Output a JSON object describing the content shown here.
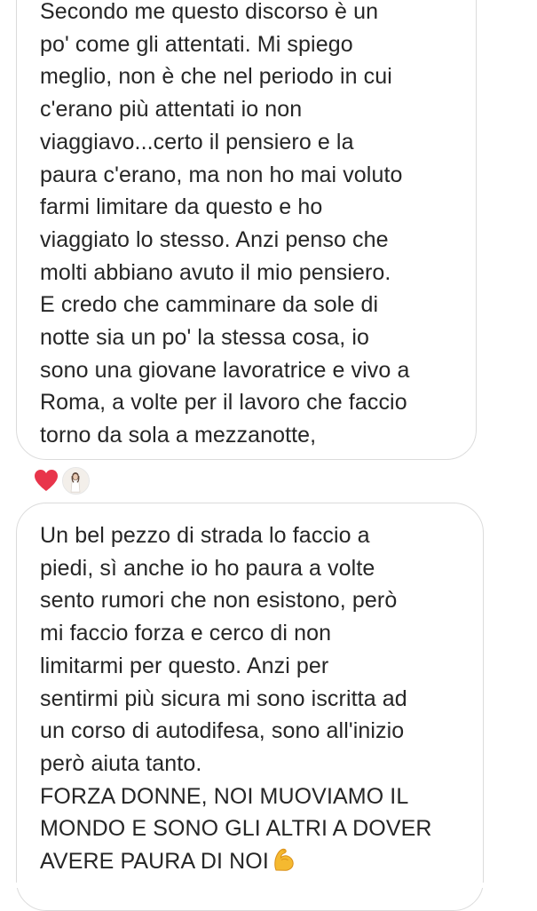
{
  "messages": [
    {
      "lines": [
        "Secondo me questo discorso è un",
        "po' come gli attentati. Mi spiego",
        "meglio, non è che nel periodo in cui",
        "c'erano più attentati io non",
        "viaggiavo...certo il pensiero e la",
        "paura c'erano, ma non ho mai voluto",
        "farmi limitare da questo e ho",
        "viaggiato lo stesso. Anzi penso che",
        "molti abbiano avuto il mio pensiero.",
        "E credo che camminare da sole di",
        "notte sia un po' la stessa cosa, io",
        "sono una giovane lavoratrice e vivo a",
        "Roma, a volte per il lavoro che faccio",
        "torno da sola a mezzanotte,"
      ],
      "reactions": [
        {
          "icon": "heart-icon",
          "color": "#e8354b"
        },
        {
          "icon": "reactor-avatar"
        }
      ]
    },
    {
      "lines": [
        "Un bel pezzo di strada lo faccio a",
        "piedi, sì anche io ho paura a volte",
        "sento rumori che non esistono, però",
        "mi faccio forza e cerco di non",
        "limitarmi per questo. Anzi per",
        "sentirmi più sicura mi sono iscritta ad",
        "un corso di autodifesa, sono all'inizio",
        "però aiuta tanto.",
        "FORZA DONNE, NOI MUOVIAMO IL",
        "MONDO E SONO GLI ALTRI A DOVER",
        "AVERE PAURA DI NOI"
      ],
      "trailing_emoji": "flexed-biceps-icon"
    }
  ],
  "colors": {
    "text": "#262626",
    "bubble_border": "#dbdbdb",
    "heart": "#e8354b",
    "emoji": "#f5b930"
  }
}
